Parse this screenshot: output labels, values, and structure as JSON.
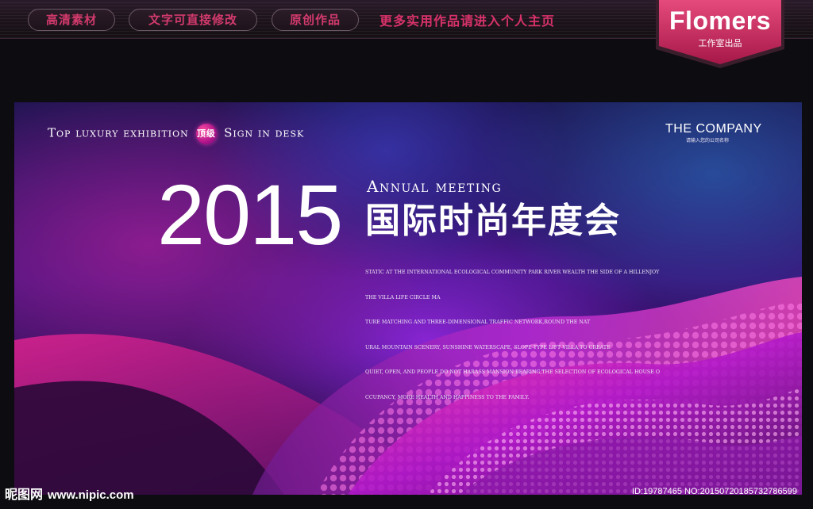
{
  "topbar": {
    "tabs": [
      "高清素材",
      "文字可直接修改",
      "原创作品"
    ],
    "note": "更多实用作品请进入个人主页",
    "brand_name": "Flomers",
    "brand_sub": "工作室出品",
    "accent": "#d8326a"
  },
  "banner": {
    "tagline_part1": "Top luxury exhibition",
    "badge": "顶级",
    "tagline_part2": "Sign in desk",
    "company": "THE COMPANY",
    "company_sub": "请输入您的公司名称",
    "year": "2015",
    "annual": "Annual meeting",
    "title_cn": "国际时尚年度会",
    "body_lines": [
      "STATIC AT THE INTERNATIONAL ECOLOGICAL COMMUNITY PARK RIVER WEALTH THE SIDE OF A HILLENJOY",
      "THE VILLA LIFE CIRCLE MA",
      "TURE MATCHING AND THREE-DIMENSIONAL TRAFFIC NETWORK,ROUND THE NAT",
      "URAL MOUNTAIN SCENERY, SUNSHINE WATERSCAPE, SLOPE TYPE LIFT VILLA,TO CREATE",
      "QUIET, OPEN, AND PEOPLE DO NOT HARASS MANSION BEARING,THE SELECTION OF ECOLOGICAL HOUSE O",
      "CCUPANCY, MORE HEALTH AND HAPPINESS TO THE FAMILY."
    ]
  },
  "watermark": {
    "site_cn": "昵图网",
    "site_url": "www.nipic.com",
    "id_text": "ID:19787465 NO:20150720185732786599"
  }
}
